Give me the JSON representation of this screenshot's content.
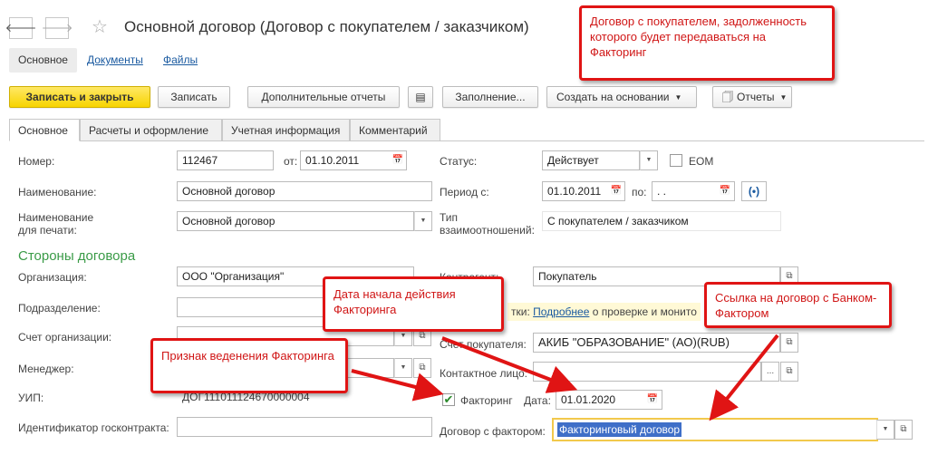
{
  "window": {
    "title": "Основной договор (Договор с покупателем / заказчиком)",
    "header_tabs": [
      "Основное",
      "Документы",
      "Файлы"
    ]
  },
  "toolbar": {
    "save_close": "Записать и закрыть",
    "save": "Записать",
    "extra_reports": "Дополнительные отчеты",
    "fill": "Заполнение...",
    "create_based": "Создать на основании",
    "reports": "Отчеты"
  },
  "form_tabs": [
    "Основное",
    "Расчеты и оформление",
    "Учетная информация",
    "Комментарий"
  ],
  "left": {
    "number_label": "Номер:",
    "number_value": "112467",
    "date_label": "от:",
    "date_value": "01.10.2011",
    "name_label": "Наименование:",
    "name_value": "Основной договор",
    "print_name_label_1": "Наименование",
    "print_name_label_2": "для печати:",
    "print_name_value": "Основной договор",
    "section_title": "Стороны договора",
    "org_label": "Организация:",
    "org_value": "ООО \"Организация\"",
    "division_label": "Подразделение:",
    "account_label": "Счет организации:",
    "manager_label": "Менеджер:",
    "uip_label": "УИП:",
    "uip_value": "ДОГ111011124670000004",
    "gov_id_label": "Идентификатор госконтракта:"
  },
  "right": {
    "status_label": "Статус:",
    "status_value": "Действует",
    "eom_label": "ЕОМ",
    "period_label": "Период с:",
    "period_from": "01.10.2011",
    "period_to_label": "по:",
    "period_to": " .  .",
    "relation_label_1": "Тип",
    "relation_label_2": "взаимоотношений:",
    "relation_value": "С покупателем / заказчиком",
    "counterparty_label": "Контрагент:",
    "counterparty_value": "Покупатель",
    "info_text_prefix": "тки:",
    "info_link": "Подробнее",
    "info_text_suffix": "о проверке и монито",
    "buyer_account_label": "Счет покупателя:",
    "buyer_account_value": "АКИБ \"ОБРАЗОВАНИЕ\" (АО)(RUB)",
    "contact_label": "Контактное лицо:",
    "factoring_label": "Факторинг",
    "factoring_date_label": "Дата:",
    "factoring_date_value": "01.01.2020",
    "factor_contract_label": "Договор с фактором:",
    "factor_contract_value": "Факторинговый договор"
  },
  "callouts": {
    "top": "Договор с покупателем, задолженность которого будет передаваться на Факторинг",
    "start_date": "Дата начала действия Факторинга",
    "sign": "Признак веденения Факторинга",
    "link": "Ссылка на договор с Банком-Фактором"
  },
  "colors": {
    "accent_red": "#e01414",
    "section_green": "#3a9b47",
    "primary_yellow": "#f7d400",
    "link_blue": "#1a5aa0"
  }
}
